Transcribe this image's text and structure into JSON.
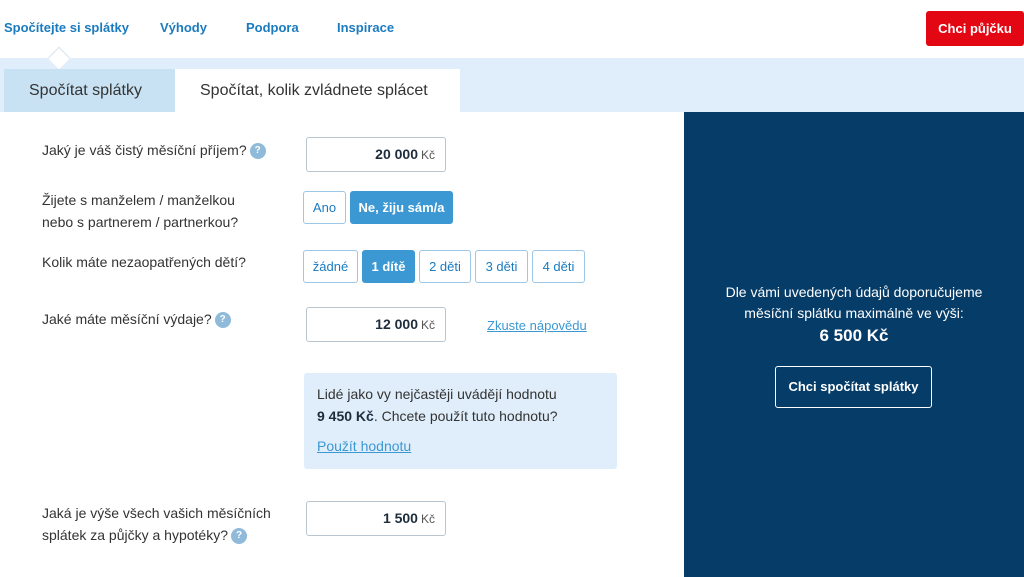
{
  "nav": {
    "links": [
      "Spočítejte si splátky",
      "Výhody",
      "Podpora",
      "Inspirace"
    ],
    "cta": "Chci půjčku"
  },
  "tabs": [
    "Spočítat splátky",
    "Spočítat, kolik zvládnete splácet"
  ],
  "form": {
    "income": {
      "label": "Jaký je váš čistý měsíční příjem?",
      "value": "20 000",
      "currency": "Kč"
    },
    "partner": {
      "label_line1": "Žijete s manželem / manželkou",
      "label_line2": "nebo s partnerem / partnerkou?",
      "options": [
        "Ano",
        "Ne, žiju sám/a"
      ],
      "selected": "Ne, žiju sám/a"
    },
    "children": {
      "label": "Kolik máte nezaopatřených dětí?",
      "options": [
        "žádné",
        "1 dítě",
        "2 děti",
        "3 děti",
        "4 děti"
      ],
      "selected": "1 dítě"
    },
    "expenses": {
      "label": "Jaké máte měsíční výdaje?",
      "value": "12 000",
      "currency": "Kč",
      "hint_link": "Zkuste nápovědu"
    },
    "hint_box": {
      "text_line1": "Lidé jako vy nejčastěji uvádějí hodnotu",
      "amount": "9 450 Kč",
      "text_line2_rest": ". Chcete použít tuto hodnotu?",
      "link": "Použít hodnotu"
    },
    "loans": {
      "label_line1": "Jaká je výše všech vašich měsíčních",
      "label_line2": "splátek za půjčky a hypotéky?",
      "value": "1 500",
      "currency": "Kč"
    },
    "help_glyph": "?"
  },
  "result": {
    "line1": "Dle vámi uvedených údajů doporučujeme",
    "line2": "měsíční splátku maximálně ve výši:",
    "amount": "6 500 Kč",
    "button": "Chci spočítat splátky"
  }
}
